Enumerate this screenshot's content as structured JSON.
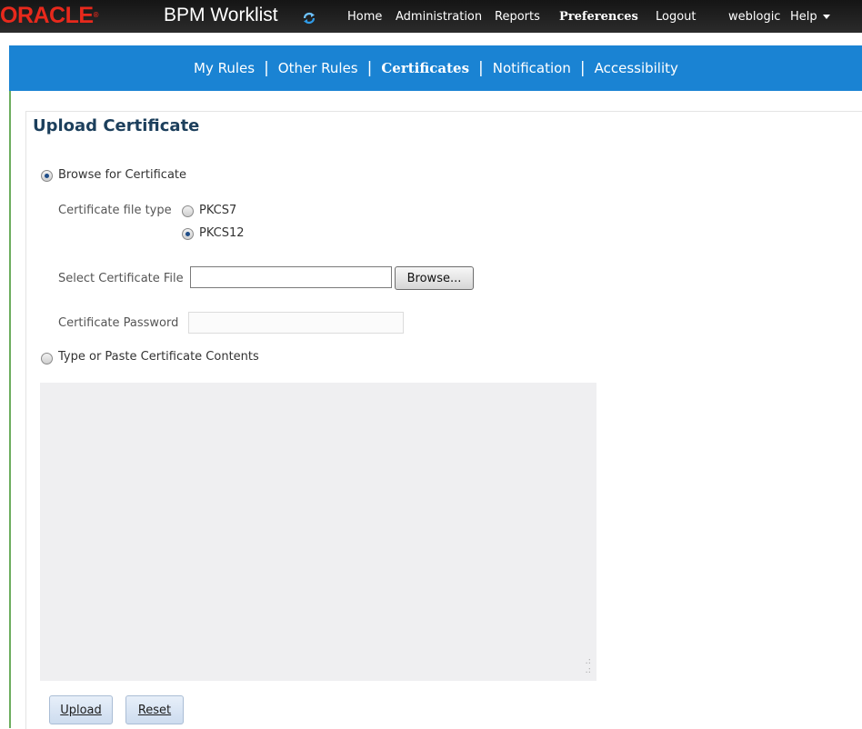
{
  "header": {
    "logo_text": "ORACLE",
    "app_title": "BPM Worklist",
    "nav": [
      "Home",
      "Administration",
      "Reports",
      "Preferences",
      "Logout"
    ],
    "user": "weblogic",
    "help": "Help"
  },
  "subnav": {
    "items": [
      "My Rules",
      "Other Rules",
      "Certificates",
      "Notification",
      "Accessibility"
    ],
    "active": "Certificates"
  },
  "page": {
    "title": "Upload Certificate",
    "browse_option": "Browse for Certificate",
    "file_type_label": "Certificate file type",
    "file_types": [
      "PKCS7",
      "PKCS12"
    ],
    "selected_file_type": "PKCS12",
    "select_file_label": "Select Certificate File",
    "file_value": "",
    "browse_button": "Browse...",
    "password_label": "Certificate Password",
    "password_value": "",
    "paste_option": "Type or Paste Certificate Contents",
    "paste_value": "",
    "upload_button": "Upload",
    "reset_button": "Reset"
  },
  "colors": {
    "topbar": "#1f1f1f",
    "subbar": "#1a83d3",
    "logo": "#e8291c",
    "title": "#1c3f5c"
  },
  "icons": [
    "refresh-icon",
    "chevron-down-icon"
  ]
}
